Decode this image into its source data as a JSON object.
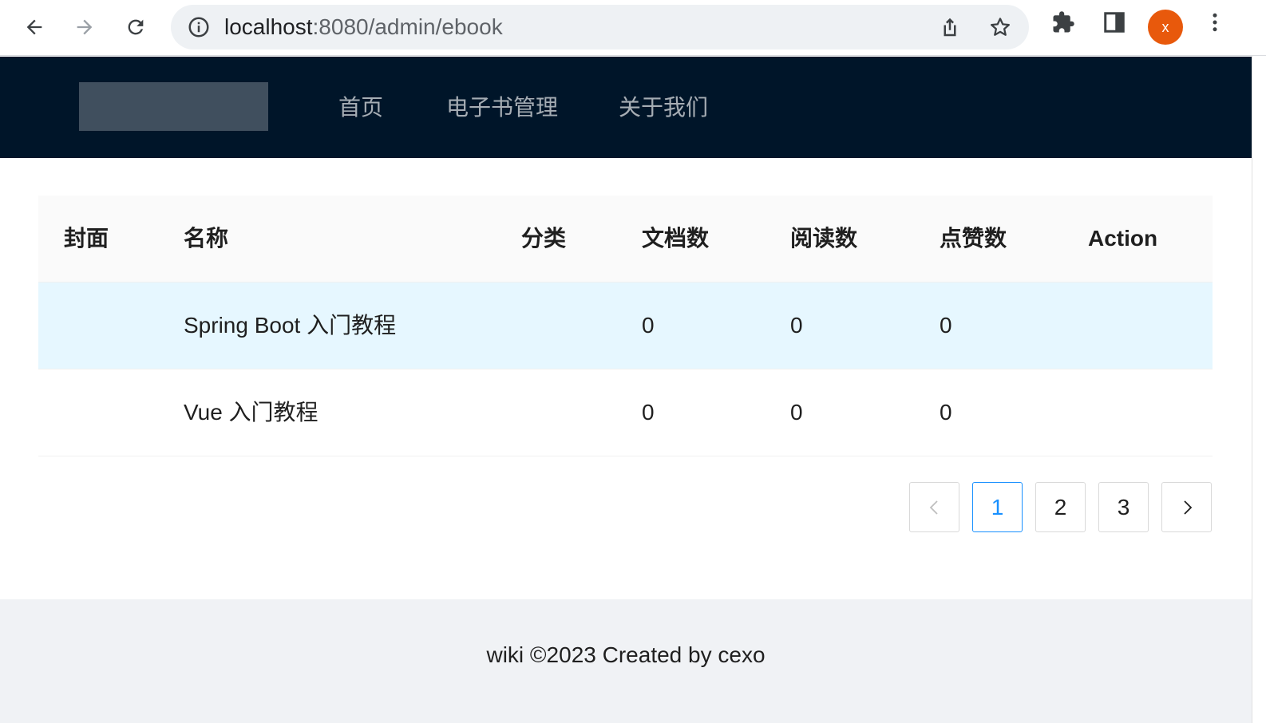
{
  "browser": {
    "url_host": "localhost",
    "url_path": ":8080/admin/ebook",
    "profile_initial": "x"
  },
  "header": {
    "menu": [
      {
        "label": "首页"
      },
      {
        "label": "电子书管理"
      },
      {
        "label": "关于我们"
      }
    ]
  },
  "table": {
    "columns": [
      "封面",
      "名称",
      "分类",
      "文档数",
      "阅读数",
      "点赞数",
      "Action"
    ],
    "rows": [
      {
        "cover": "",
        "name": "Spring Boot 入门教程",
        "category": "",
        "doc_count": "0",
        "view_count": "0",
        "vote_count": "0",
        "action": ""
      },
      {
        "cover": "",
        "name": "Vue 入门教程",
        "category": "",
        "doc_count": "0",
        "view_count": "0",
        "vote_count": "0",
        "action": ""
      }
    ]
  },
  "pagination": {
    "pages": [
      "1",
      "2",
      "3"
    ],
    "current": "1"
  },
  "footer": {
    "text": "wiki ©2023 Created by cexo"
  },
  "colors": {
    "header_bg": "#001529",
    "accent": "#1890ff",
    "row_hover": "#e6f7ff",
    "footer_bg": "#f0f2f5",
    "avatar": "#e8590c"
  }
}
